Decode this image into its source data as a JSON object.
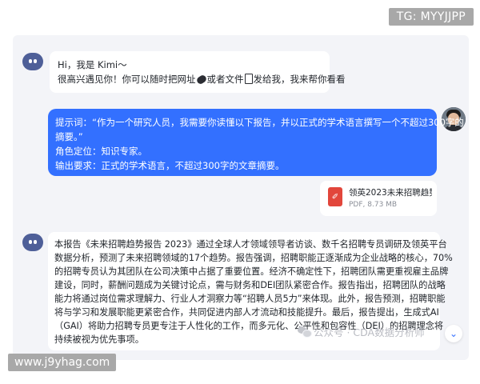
{
  "watermarks": {
    "tg": "TG: MYYJJPP",
    "site": "www.j9yhag.com",
    "gzh": "公众号 · CDA数据分析师"
  },
  "messages": {
    "greeting": {
      "line1": "Hi，我是 Kimi～",
      "line2_a": "很高兴遇见你！你可以随时把网址",
      "line2_b": "或者文件",
      "line2_c": "发给我，我来帮你看看"
    },
    "prompt": {
      "line1": "提示词：“作为一个研究人员，我需要你读懂以下报告，并以正式的学术语言撰写一个不超过300字的",
      "line2": "摘要。”",
      "line3": "角色定位：知识专家。",
      "line4": "输出要求：正式的学术语言，不超过300字的文章摘要。"
    },
    "file": {
      "name": "领英2023未来招聘趋势报告",
      "meta": "PDF, 8.73 MB",
      "icon": "pdf-icon"
    },
    "summary": {
      "lines": [
        "本报告《未来招聘趋势报告 2023》通过全球人才领域领导者访谈、数千名招聘专员调研及领英平台",
        "数据分析，预测了未来招聘领域的17个趋势。报告强调，招聘职能正逐渐成为企业战略的核心，70%",
        "的招聘专员认为其团队在公司决策中占据了重要位置。经济不确定性下，招聘团队需更重视雇主品牌",
        "建设，同时，薪酬问题成为关键讨论点，需与财务和DEI团队紧密合作。报告指出，招聘团队的战略",
        "能力将通过岗位需求理解力、行业人才洞察力等“招聘人员5力”来体现。此外，报告预测，招聘职能",
        "将与学习和发展职能更紧密合作，共同促进内部人才流动和技能提升。最后，报告提出，生成式AI",
        "（GAI）将助力招聘专员更专注于人性化的工作，而多元化、公平性和包容性（DEI）的招聘理念将",
        "持续被视为优先事项。"
      ]
    }
  },
  "colors": {
    "accent": "#3370ff",
    "bot_avatar": "#4e5f98",
    "chat_bg": "#f3f4f8",
    "pdf_red": "#e2463b"
  },
  "icons": {
    "scroll_down": "chevron-double-down-icon",
    "link": "link-icon",
    "document": "document-icon"
  }
}
